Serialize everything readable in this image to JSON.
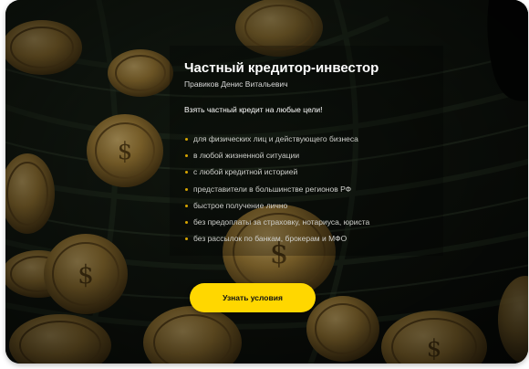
{
  "card": {
    "title": "Частный кредитор-инвестор",
    "subtitle": "Правиков Денис Витальевич",
    "lead": "Взять частный кредит на любые цели!",
    "features": [
      "для физических лиц и действующего бизнеса",
      "в любой жизненной ситуации",
      "с любой кредитной историей",
      "представители в большинстве регионов РФ",
      "быстрое получение лично",
      "без предоплаты за страховку, нотариуса, юриста",
      "без рассылок по банкам, брокерам и МФО"
    ],
    "cta_label": "Узнать условия"
  },
  "colors": {
    "accent": "#ffd700",
    "bullet": "#d6a400",
    "background": "#0c0f0b",
    "coin": "#b08a3c"
  },
  "background_image": "gold-coins-on-dark-leaves"
}
